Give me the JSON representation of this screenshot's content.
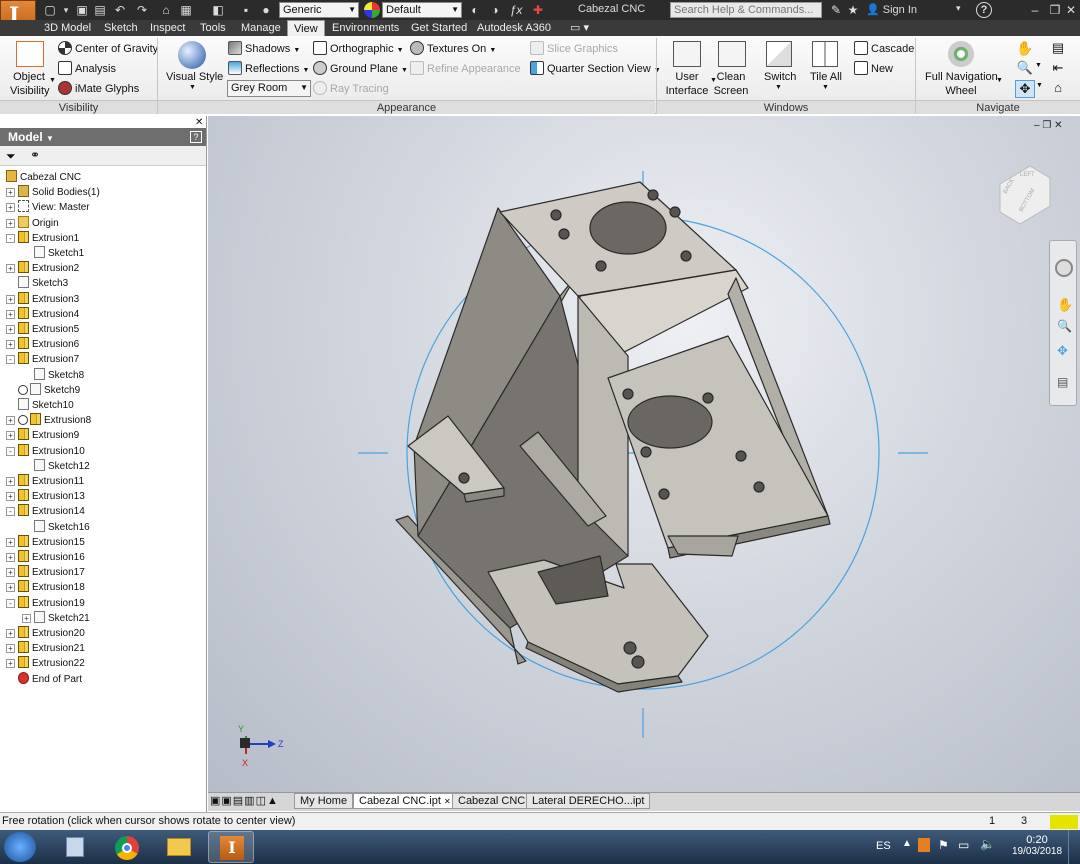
{
  "titlebar": {
    "app_badge": "LT",
    "material_combo": "Generic",
    "appearance_combo": "Default",
    "document_title": "Cabezal CNC",
    "search_placeholder": "Search Help & Commands...",
    "sign_in": "Sign In",
    "help": "?"
  },
  "ribbon_tabs": [
    "3D Model",
    "Sketch",
    "Inspect",
    "Tools",
    "Manage",
    "View",
    "Environments",
    "Get Started",
    "Autodesk A360"
  ],
  "active_tab": "View",
  "ribbon": {
    "visibility": {
      "label": "Visibility",
      "object_visibility": [
        "Object",
        "Visibility"
      ],
      "center_of_gravity": "Center of Gravity",
      "analysis": "Analysis",
      "imate_glyphs": "iMate Glyphs"
    },
    "appearance": {
      "label": "Appearance",
      "visual_style": "Visual Style",
      "shadows": "Shadows",
      "reflections": "Reflections",
      "environment_combo": "Grey Room",
      "orthographic": "Orthographic",
      "ground_plane": "Ground Plane",
      "ray_tracing": "Ray Tracing",
      "textures_on": "Textures On",
      "refine_appearance": "Refine Appearance",
      "slice_graphics": "Slice Graphics",
      "quarter_section_view": "Quarter Section View"
    },
    "windows": {
      "label": "Windows",
      "user_interface": [
        "User",
        "Interface"
      ],
      "clean_screen": [
        "Clean",
        "Screen"
      ],
      "switch": "Switch",
      "tile_all": "Tile All",
      "cascade": "Cascade",
      "new": "New"
    },
    "navigate": {
      "label": "Navigate",
      "full_navigation_wheel": [
        "Full Navigation",
        "Wheel"
      ]
    }
  },
  "browser": {
    "title": "Model",
    "root": "Cabezal CNC",
    "items": [
      {
        "label": "Solid Bodies(1)",
        "icon": "body",
        "level": 1,
        "expander": "+"
      },
      {
        "label": "View: Master",
        "icon": "view",
        "level": 1,
        "expander": "+"
      },
      {
        "label": "Origin",
        "icon": "fold",
        "level": 1,
        "expander": "+"
      },
      {
        "label": "Extrusion1",
        "icon": "ext",
        "level": 1,
        "expander": "-"
      },
      {
        "label": "Sketch1",
        "icon": "sk",
        "level": 2,
        "expander": ""
      },
      {
        "label": "Extrusion2",
        "icon": "ext",
        "level": 1,
        "expander": "+"
      },
      {
        "label": "Sketch3",
        "icon": "sk",
        "level": 1,
        "expander": ""
      },
      {
        "label": "Extrusion3",
        "icon": "ext",
        "level": 1,
        "expander": "+"
      },
      {
        "label": "Extrusion4",
        "icon": "ext",
        "level": 1,
        "expander": "+"
      },
      {
        "label": "Extrusion5",
        "icon": "ext",
        "level": 1,
        "expander": "+"
      },
      {
        "label": "Extrusion6",
        "icon": "ext",
        "level": 1,
        "expander": "+"
      },
      {
        "label": "Extrusion7",
        "icon": "ext",
        "level": 1,
        "expander": "-"
      },
      {
        "label": "Sketch8",
        "icon": "sk",
        "level": 2,
        "expander": ""
      },
      {
        "label": "Sketch9",
        "icon": "sk",
        "level": 1,
        "expander": "",
        "info": true
      },
      {
        "label": "Sketch10",
        "icon": "sk",
        "level": 1,
        "expander": ""
      },
      {
        "label": "Extrusion8",
        "icon": "ext",
        "level": 1,
        "expander": "+",
        "info": true
      },
      {
        "label": "Extrusion9",
        "icon": "ext",
        "level": 1,
        "expander": "+"
      },
      {
        "label": "Extrusion10",
        "icon": "ext",
        "level": 1,
        "expander": "-"
      },
      {
        "label": "Sketch12",
        "icon": "sk",
        "level": 2,
        "expander": ""
      },
      {
        "label": "Extrusion11",
        "icon": "ext",
        "level": 1,
        "expander": "+"
      },
      {
        "label": "Extrusion13",
        "icon": "ext",
        "level": 1,
        "expander": "+"
      },
      {
        "label": "Extrusion14",
        "icon": "ext",
        "level": 1,
        "expander": "-"
      },
      {
        "label": "Sketch16",
        "icon": "sk",
        "level": 2,
        "expander": ""
      },
      {
        "label": "Extrusion15",
        "icon": "ext",
        "level": 1,
        "expander": "+"
      },
      {
        "label": "Extrusion16",
        "icon": "ext",
        "level": 1,
        "expander": "+"
      },
      {
        "label": "Extrusion17",
        "icon": "ext",
        "level": 1,
        "expander": "+"
      },
      {
        "label": "Extrusion18",
        "icon": "ext",
        "level": 1,
        "expander": "+"
      },
      {
        "label": "Extrusion19",
        "icon": "ext",
        "level": 1,
        "expander": "-"
      },
      {
        "label": "Sketch21",
        "icon": "sk",
        "level": 2,
        "expander": "+"
      },
      {
        "label": "Extrusion20",
        "icon": "ext",
        "level": 1,
        "expander": "+"
      },
      {
        "label": "Extrusion21",
        "icon": "ext",
        "level": 1,
        "expander": "+"
      },
      {
        "label": "Extrusion22",
        "icon": "ext",
        "level": 1,
        "expander": "+"
      },
      {
        "label": "End of Part",
        "icon": "end",
        "level": 1,
        "expander": ""
      }
    ]
  },
  "viewcube": {
    "faces": [
      "LEFT",
      "BACK",
      "BOTTOM"
    ]
  },
  "triad": {
    "axes": [
      "Y",
      "Z",
      "X"
    ]
  },
  "document_tabs": [
    "My Home",
    "Cabezal CNC.ipt",
    "Cabezal CNC",
    "Lateral DERECHO...ipt"
  ],
  "active_document_tab": "Cabezal CNC.ipt",
  "status": {
    "message": "Free rotation (click when cursor shows rotate to center view)",
    "count1": "1",
    "count2": "3"
  },
  "taskbar": {
    "language": "ES",
    "time": "0:20",
    "date": "19/03/2018",
    "apps": [
      "start-orb-icon",
      "files-icon",
      "chrome-icon",
      "folder-icon",
      "inventor-icon"
    ]
  },
  "colors": {
    "accent": "#4aa3df",
    "titlebar": "#2b2b2b",
    "viewport_top": "#eef0f4",
    "viewport_bottom": "#b6bcc8",
    "part": "#c9c6c0"
  }
}
